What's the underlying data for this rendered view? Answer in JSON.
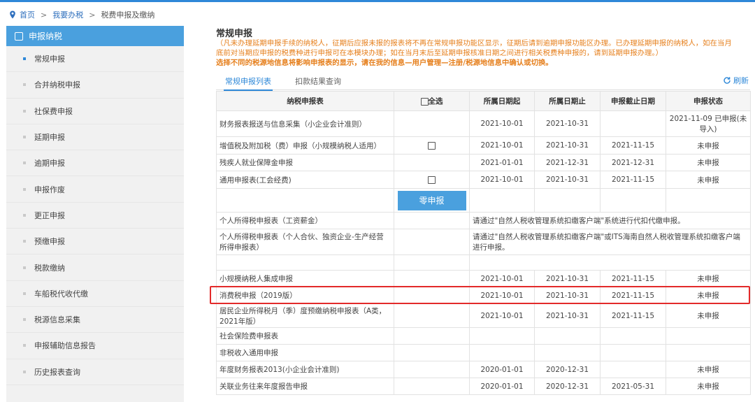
{
  "breadcrumb": {
    "home": "首页",
    "sep1": ">",
    "mid": "我要办税",
    "sep2": ">",
    "current": "税费申报及缴纳"
  },
  "sidebar": {
    "header": "申报纳税",
    "items": [
      {
        "label": "常规申报",
        "active": true
      },
      {
        "label": "合并纳税申报"
      },
      {
        "label": "社保费申报"
      },
      {
        "label": "延期申报"
      },
      {
        "label": "逾期申报"
      },
      {
        "label": "申报作废"
      },
      {
        "label": "更正申报"
      },
      {
        "label": "预缴申报"
      },
      {
        "label": "税款缴纳"
      },
      {
        "label": "车船税代收代缴"
      },
      {
        "label": "税源信息采集"
      },
      {
        "label": "申报辅助信息报告"
      },
      {
        "label": "历史报表查询"
      }
    ]
  },
  "main": {
    "title": "常规申报",
    "notice_line1": "（凡未办理延期申报手续的纳税人，征期后应报未报的报表将不再在常规申报功能区显示，征期后请到逾期申报功能区办理。已办理延期申报的纳税人，如在当月",
    "notice_line2": "底前对当期应申报的税费种进行申报可在本模块办理；如在当月末后至延期申报核准日期之间进行相关税费种申报的，请到延期申报办理。）",
    "notice_bold": "选择不同的税源地信息将影响申报表的显示，请在我的信息—用户管理—注册/税源地信息中确认或切换。",
    "tabs": [
      "常规申报列表",
      "扣款结果查询"
    ],
    "refresh": "刷新",
    "headers": [
      "纳税申报表",
      "全选",
      "所属日期起",
      "所属日期止",
      "申报截止日期",
      "申报状态"
    ],
    "zero_button": "零申报",
    "rows": [
      {
        "name": "财务报表报送与信息采集（小企业会计准则）",
        "cb": false,
        "start": "2021-10-01",
        "end": "2021-10-31",
        "deadline": "",
        "status": "2021-11-09 已申报(未导入)"
      },
      {
        "name": "增值税及附加税（费）申报（小规模纳税人适用）",
        "cb": true,
        "start": "2021-10-01",
        "end": "2021-10-31",
        "deadline": "2021-11-15",
        "status": "未申报"
      },
      {
        "name": "残疾人就业保障金申报",
        "cb": false,
        "start": "2021-01-01",
        "end": "2021-12-31",
        "deadline": "2021-12-31",
        "status": "未申报"
      },
      {
        "name": "通用申报表(工会经费)",
        "cb": true,
        "start": "2021-10-01",
        "end": "2021-10-31",
        "deadline": "2021-11-15",
        "status": "未申报"
      }
    ],
    "personal_rows": [
      {
        "name": "个人所得税申报表（工资薪金）",
        "msg": "请通过\"自然人税收管理系统扣缴客户端\"系统进行代扣代缴申报。"
      },
      {
        "name": "个人所得税申报表（个人合伙、独资企业-生产经营所得申报表）",
        "msg": "请通过\"自然人税收管理系统扣缴客户端\"或ITS海南自然人税收管理系统扣缴客户端进行申报。"
      }
    ],
    "rows2": [
      {
        "name": "小规模纳税人集成申报",
        "start": "2021-10-01",
        "end": "2021-10-31",
        "deadline": "2021-11-15",
        "status": "未申报"
      },
      {
        "name": "消费税申报（2019版）",
        "start": "2021-10-01",
        "end": "2021-10-31",
        "deadline": "2021-11-15",
        "status": "未申报"
      },
      {
        "name": "居民企业所得税月（季）度预缴纳税申报表（A类，2021年版）",
        "start": "2021-10-01",
        "end": "2021-10-31",
        "deadline": "2021-11-15",
        "status": "未申报"
      },
      {
        "name": "社会保险费申报表",
        "start": "",
        "end": "",
        "deadline": "",
        "status": ""
      },
      {
        "name": "非税收入通用申报",
        "start": "",
        "end": "",
        "deadline": "",
        "status": ""
      },
      {
        "name": "年度财务报表2013(小企业会计准则)",
        "start": "2020-01-01",
        "end": "2020-12-31",
        "deadline": "",
        "status": "未申报"
      },
      {
        "name": "关联业务往来年度报告申报",
        "start": "2020-01-01",
        "end": "2020-12-31",
        "deadline": "2021-05-31",
        "status": "未申报"
      }
    ]
  }
}
